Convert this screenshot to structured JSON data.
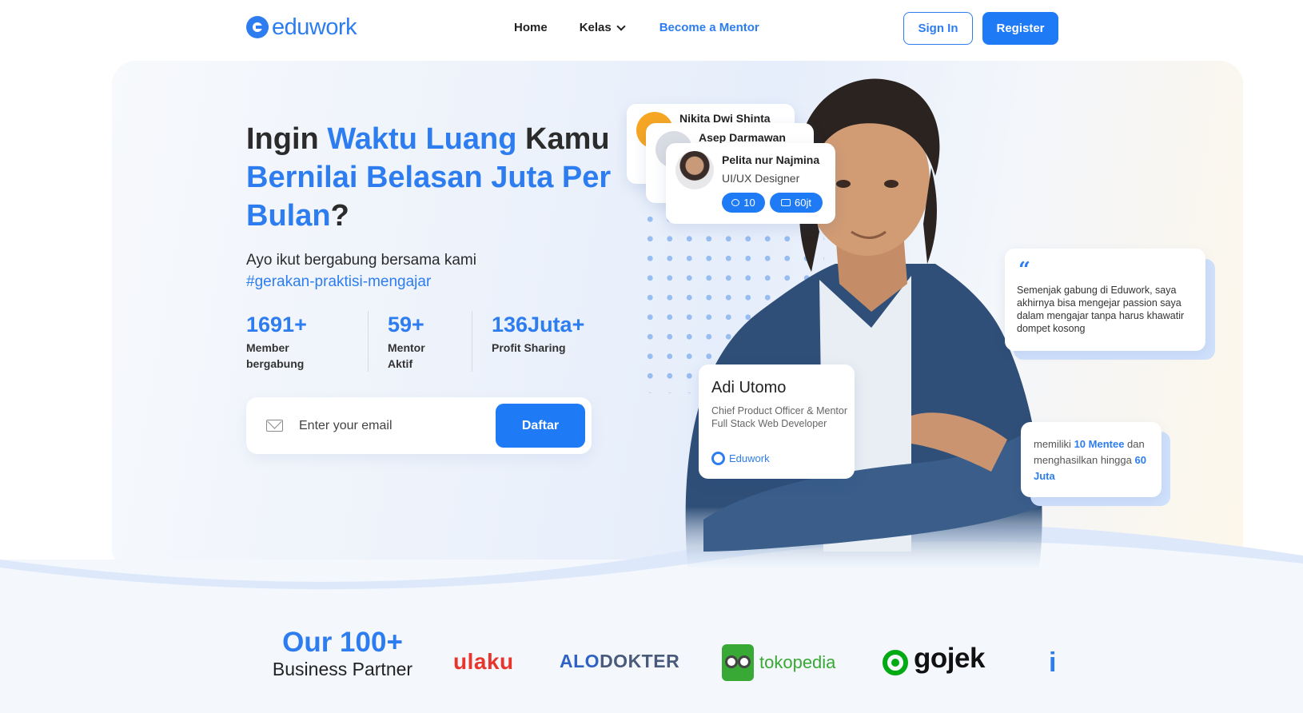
{
  "header": {
    "logo_text": "eduwork",
    "nav": {
      "home": "Home",
      "kelas": "Kelas",
      "become_mentor": "Become a Mentor"
    },
    "sign_in": "Sign In",
    "register": "Register"
  },
  "hero": {
    "headline": {
      "part1": "Ingin ",
      "part2": "Waktu Luang",
      "part3": " Kamu ",
      "part4": "Bernilai Belasan Juta Per Bulan",
      "part5": "?"
    },
    "subtitle": "Ayo ikut bergabung bersama kami",
    "hashtag": "#gerakan-praktisi-mengajar",
    "stats": [
      {
        "value": "1691+",
        "label": "Member bergabung"
      },
      {
        "value": "59+",
        "label": "Mentor Aktif"
      },
      {
        "value": "136Juta+",
        "label": "Profit Sharing"
      }
    ],
    "email_placeholder": "Enter your email",
    "daftar": "Daftar"
  },
  "mentor_cards": {
    "card_a_name": "Nikita Dwi Shinta",
    "card_b_name": "Asep Darmawan",
    "card_c_name": "Pelita nur Najmina",
    "card_c_role": "UI/UX Designer",
    "card_c_mentees": "10",
    "card_c_income": "60jt"
  },
  "quote": {
    "mark": "“",
    "text": "Semenjak gabung di Eduwork, saya akhirnya bisa mengejar passion saya dalam mengajar tanpa harus khawatir dompet kosong"
  },
  "featured_mentor": {
    "name": "Adi Utomo",
    "role": "Chief Product Officer & Mentor Full Stack Web Developer",
    "brand": "Eduwork"
  },
  "mentee_card": {
    "prefix": "memiliki ",
    "mentees": "10 Mentee",
    "middle": " dan menghasilkan hingga ",
    "income": "60 Juta"
  },
  "partners": {
    "title": "Our 100+",
    "subtitle": "Business Partner",
    "logos": {
      "ulaku": "ulaku",
      "alo_a": "ALO",
      "alo_b": "DOKTER",
      "tokopedia": "tokopedia",
      "gojek": "gojek",
      "partial": "i"
    }
  },
  "colors": {
    "brand": "#2d7df0",
    "button": "#1f7af5",
    "tokopedia": "#39a935",
    "gojek": "#00aa13",
    "ulaku": "#e8362d"
  }
}
